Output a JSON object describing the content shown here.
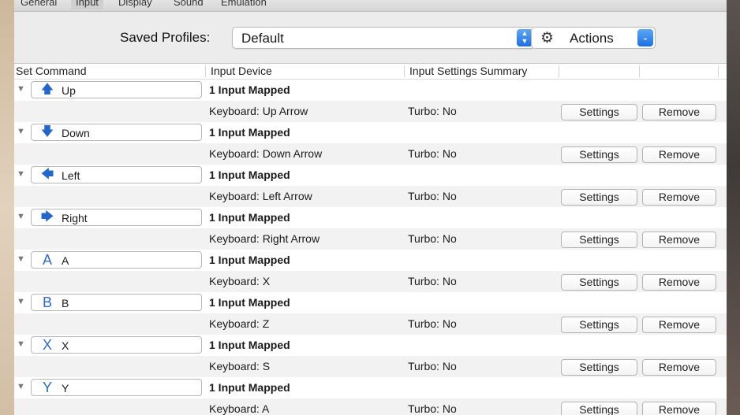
{
  "tabs": [
    "General",
    "Input",
    "Display",
    "Sound",
    "Emulation"
  ],
  "profile": {
    "label": "Saved Profiles:",
    "value": "Default",
    "actions_label": "Actions"
  },
  "columns": {
    "set_command": "Set Command",
    "input_device": "Input Device",
    "summary": "Input Settings Summary"
  },
  "buttons": {
    "settings": "Settings",
    "remove": "Remove"
  },
  "commands": [
    {
      "icon": "arrow-up-icon",
      "glyph": "🡅",
      "label": "Up",
      "mapped": "1 Input Mapped",
      "device": "Keyboard: Up Arrow",
      "turbo": "Turbo: No"
    },
    {
      "icon": "arrow-down-icon",
      "glyph": "🡇",
      "label": "Down",
      "mapped": "1 Input Mapped",
      "device": "Keyboard: Down Arrow",
      "turbo": "Turbo: No"
    },
    {
      "icon": "arrow-left-icon",
      "glyph": "🡄",
      "label": "Left",
      "mapped": "1 Input Mapped",
      "device": "Keyboard: Left Arrow",
      "turbo": "Turbo: No"
    },
    {
      "icon": "arrow-right-icon",
      "glyph": "🡆",
      "label": "Right",
      "mapped": "1 Input Mapped",
      "device": "Keyboard: Right Arrow",
      "turbo": "Turbo: No"
    },
    {
      "icon": "letter-a-icon",
      "glyph": "A",
      "label": "A",
      "mapped": "1 Input Mapped",
      "device": "Keyboard: X",
      "turbo": "Turbo: No"
    },
    {
      "icon": "letter-b-icon",
      "glyph": "B",
      "label": "B",
      "mapped": "1 Input Mapped",
      "device": "Keyboard: Z",
      "turbo": "Turbo: No"
    },
    {
      "icon": "letter-x-icon",
      "glyph": "X",
      "label": "X",
      "mapped": "1 Input Mapped",
      "device": "Keyboard: S",
      "turbo": "Turbo: No"
    },
    {
      "icon": "letter-y-icon",
      "glyph": "Y",
      "label": "Y",
      "mapped": "1 Input Mapped",
      "device": "Keyboard: A",
      "turbo": "Turbo: No"
    }
  ],
  "colors": {
    "accent": "#1a6fe4",
    "icon_blue": "#2466c9"
  }
}
